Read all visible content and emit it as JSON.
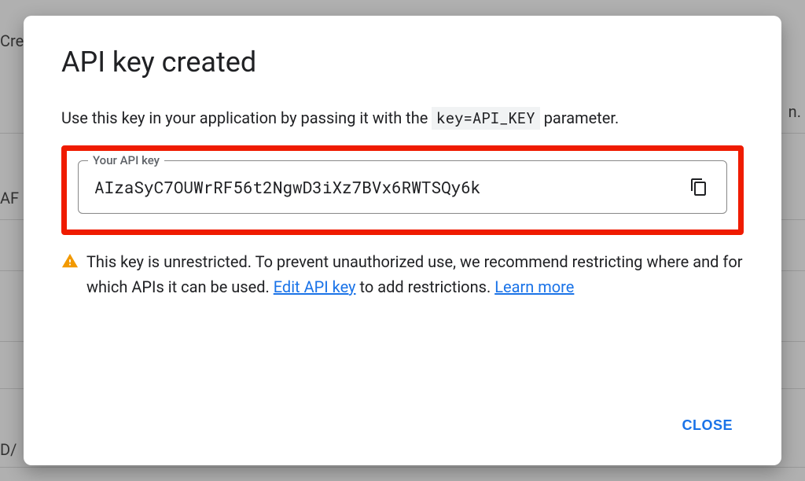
{
  "backdrop": {
    "text1": "Cre",
    "text2": "n.",
    "text3": "AF",
    "text4": "D/"
  },
  "dialog": {
    "title": "API key created",
    "description_prefix": "Use this key in your application by passing it with the ",
    "description_code": "key=API_KEY",
    "description_suffix": " parameter.",
    "api_key": {
      "label": "Your API key",
      "value": "AIzaSyC7OUWrRF56t2NgwD3iXz7BVx6RWTSQy6k"
    },
    "warning": {
      "text_prefix": "This key is unrestricted. To prevent unauthorized use, we recommend restricting where and for which APIs it can be used. ",
      "edit_link": "Edit API key",
      "text_mid": " to add restrictions. ",
      "learn_link": "Learn more"
    },
    "close_label": "CLOSE"
  }
}
